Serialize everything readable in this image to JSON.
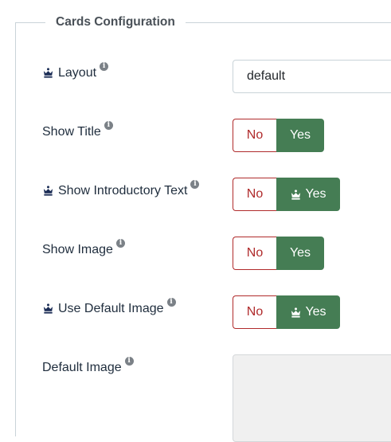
{
  "fieldset": {
    "legend": "Cards Configuration"
  },
  "rows": [
    {
      "label": "Layout",
      "value": "default"
    },
    {
      "label": "Show Title",
      "no": "No",
      "yes": "Yes"
    },
    {
      "label": "Show Introductory Text",
      "no": "No",
      "yes": "Yes"
    },
    {
      "label": "Show Image",
      "no": "No",
      "yes": "Yes"
    },
    {
      "label": "Use Default Image",
      "no": "No",
      "yes": "Yes"
    },
    {
      "label": "Default Image"
    }
  ],
  "info_glyph": "i",
  "colors": {
    "yes_active": "#457d54",
    "no_border": "#b02b2c",
    "label": "#1f2d3d",
    "crown": "#1a2c55"
  }
}
